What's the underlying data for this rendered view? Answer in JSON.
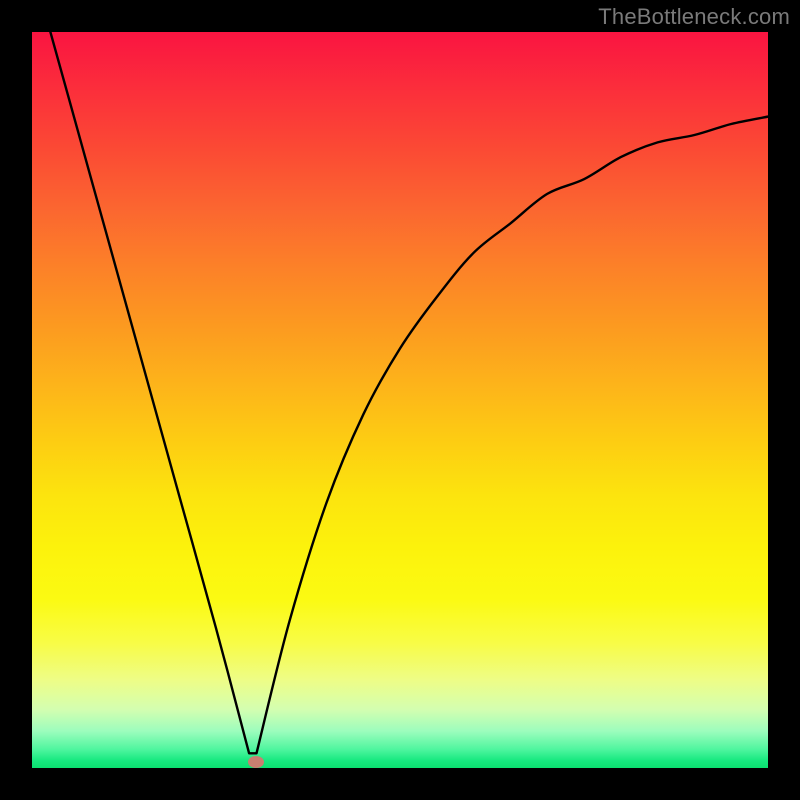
{
  "attribution": "TheBottleneck.com",
  "colors": {
    "frame": "#000000",
    "gradient_top": "#fa1441",
    "gradient_bottom": "#0be070",
    "curve": "#000000",
    "marker": "#c97f70",
    "attribution_text": "#7a7a7a"
  },
  "chart_data": {
    "type": "line",
    "title": "",
    "xlabel": "",
    "ylabel": "",
    "xlim": [
      0,
      1
    ],
    "ylim": [
      0,
      1
    ],
    "x": [
      0.025,
      0.05,
      0.1,
      0.15,
      0.2,
      0.25,
      0.295,
      0.305,
      0.35,
      0.4,
      0.45,
      0.5,
      0.55,
      0.6,
      0.65,
      0.7,
      0.75,
      0.8,
      0.85,
      0.9,
      0.95,
      1.0
    ],
    "values": [
      1.0,
      0.91,
      0.73,
      0.55,
      0.37,
      0.19,
      0.02,
      0.02,
      0.2,
      0.36,
      0.48,
      0.57,
      0.64,
      0.7,
      0.74,
      0.78,
      0.8,
      0.83,
      0.85,
      0.86,
      0.875,
      0.885
    ],
    "marker": {
      "x": 0.305,
      "y": 0.008
    },
    "grid": false,
    "legend": false
  }
}
